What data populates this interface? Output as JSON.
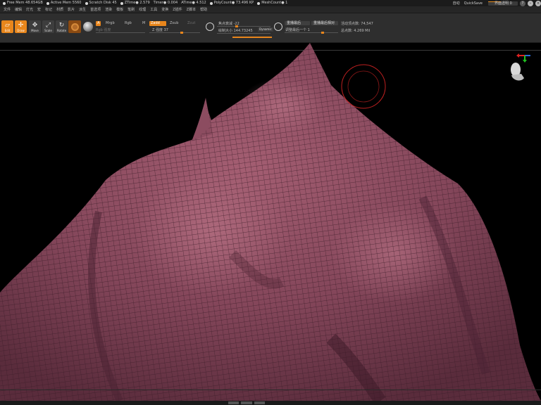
{
  "statusbar": {
    "items": [
      "Free Mem 48.654GB",
      "Active Mem 5560",
      "Scratch Disk 45",
      "ZTime● 2.579",
      "Timer● 0.004",
      "ATime● 4.512",
      "PolyCount● 73.496 KP",
      "MeshCount● 1"
    ],
    "autosave_label": "自动",
    "quicksave_label": "QuickSave",
    "transparency_label": "界面透明 0"
  },
  "menubar": {
    "items": [
      "文件",
      "编辑",
      "灯光",
      "宏",
      "标记",
      "材质",
      "影片",
      "派生",
      "首选项",
      "渲染",
      "模板",
      "笔刷",
      "纹理",
      "工具",
      "变换",
      "Z插件",
      "Z脚本",
      "帮助"
    ]
  },
  "toolbar": {
    "edit_label": "Edit",
    "draw_label": "Draw",
    "move_label": "Move",
    "scale_label": "Scale",
    "rotate_label": "Rotate",
    "a_label": "A",
    "mrgb_label": "Mrgb",
    "rgb_label": "Rgb",
    "m_label": "M",
    "zadd_label": "Zadd",
    "zsub_label": "Zsub",
    "zcut_label": "Zcut",
    "rgb_intensity_label": "Rgb 强度",
    "z_intensity_label": "Z 强度 37",
    "focal_shift_label": "焦点衰减 -22",
    "draw_size_label": "绘制大小 144.73245",
    "dynamic_label": "Dynamic",
    "replay_last_label": "重播最后",
    "replay_last_rel_label": "重播最后相对",
    "adjust_last_label": "调整最后一个 1",
    "active_points_label": "活动顶点数: 74,547",
    "total_points_label": "总点数: 4.269 Mil"
  },
  "colors": {
    "accent": "#e8861c",
    "mesh": "#8a4a5e",
    "wire": "#3a1c28"
  }
}
